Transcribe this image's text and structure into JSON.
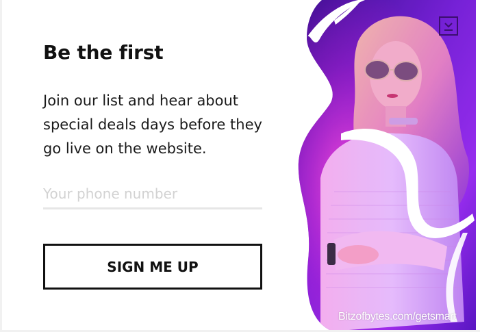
{
  "popup": {
    "title": "Be the first",
    "description": "Join our list and hear about special deals days before they go live on the website.",
    "phone_placeholder": "Your phone number",
    "phone_value": "",
    "cta_label": "SIGN ME UP",
    "close_icon": "close-icon"
  },
  "hero": {
    "watermark": "Bitzofbytes.com/getsmart",
    "accent_colors": [
      "#3b0ea8",
      "#7c22e6",
      "#e11fc9",
      "#ff4fd8"
    ]
  }
}
